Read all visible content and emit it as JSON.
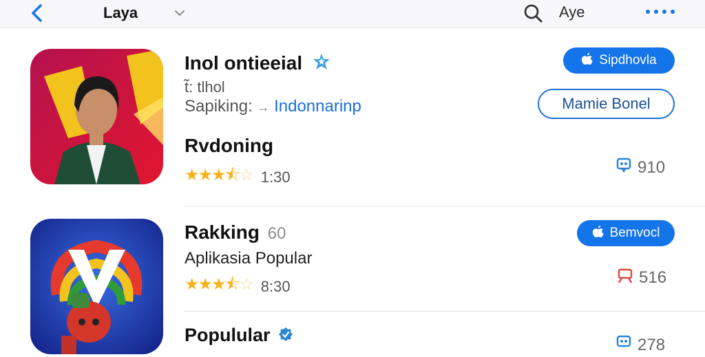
{
  "header": {
    "title": "Laya",
    "right_label": "Aye"
  },
  "apps": [
    {
      "name": "Inol ontieeial",
      "subtitle": "t̃: tlhol",
      "category_prefix": "Sapiking: ",
      "category_arrow": "→",
      "category_link": "Indonnarinp",
      "section": "Rvdoning",
      "rating_value": 3.5,
      "rating_text": "1:30",
      "primary_button": "Sipdhovla",
      "secondary_button": "Mamie Bonel",
      "count": "910",
      "count_color": "#2a84d8",
      "icon_colors": [
        "#c8155a",
        "#f2c31c",
        "#1f4d35"
      ]
    },
    {
      "name": "Rakking",
      "name_suffix": "60",
      "subtitle": "Aplikasia Popular",
      "rating_value": 3.5,
      "rating_text": "8:30",
      "primary_button": "Bemvocl",
      "count": "516",
      "count_color": "#d84a3a",
      "icon_colors": [
        "#1f3fb0",
        "#e53a2d",
        "#2f9b3a"
      ]
    },
    {
      "name": "Populular",
      "count": "278",
      "count_color": "#2a84d8"
    }
  ],
  "colors": {
    "accent": "#1474ea",
    "star": "#f6b21b"
  },
  "icons": [
    "back-chevron-icon",
    "dropdown-chevron-icon",
    "search-icon",
    "more-dots-icon",
    "verified-badge-icon",
    "apple-icon",
    "download-count-icon"
  ]
}
